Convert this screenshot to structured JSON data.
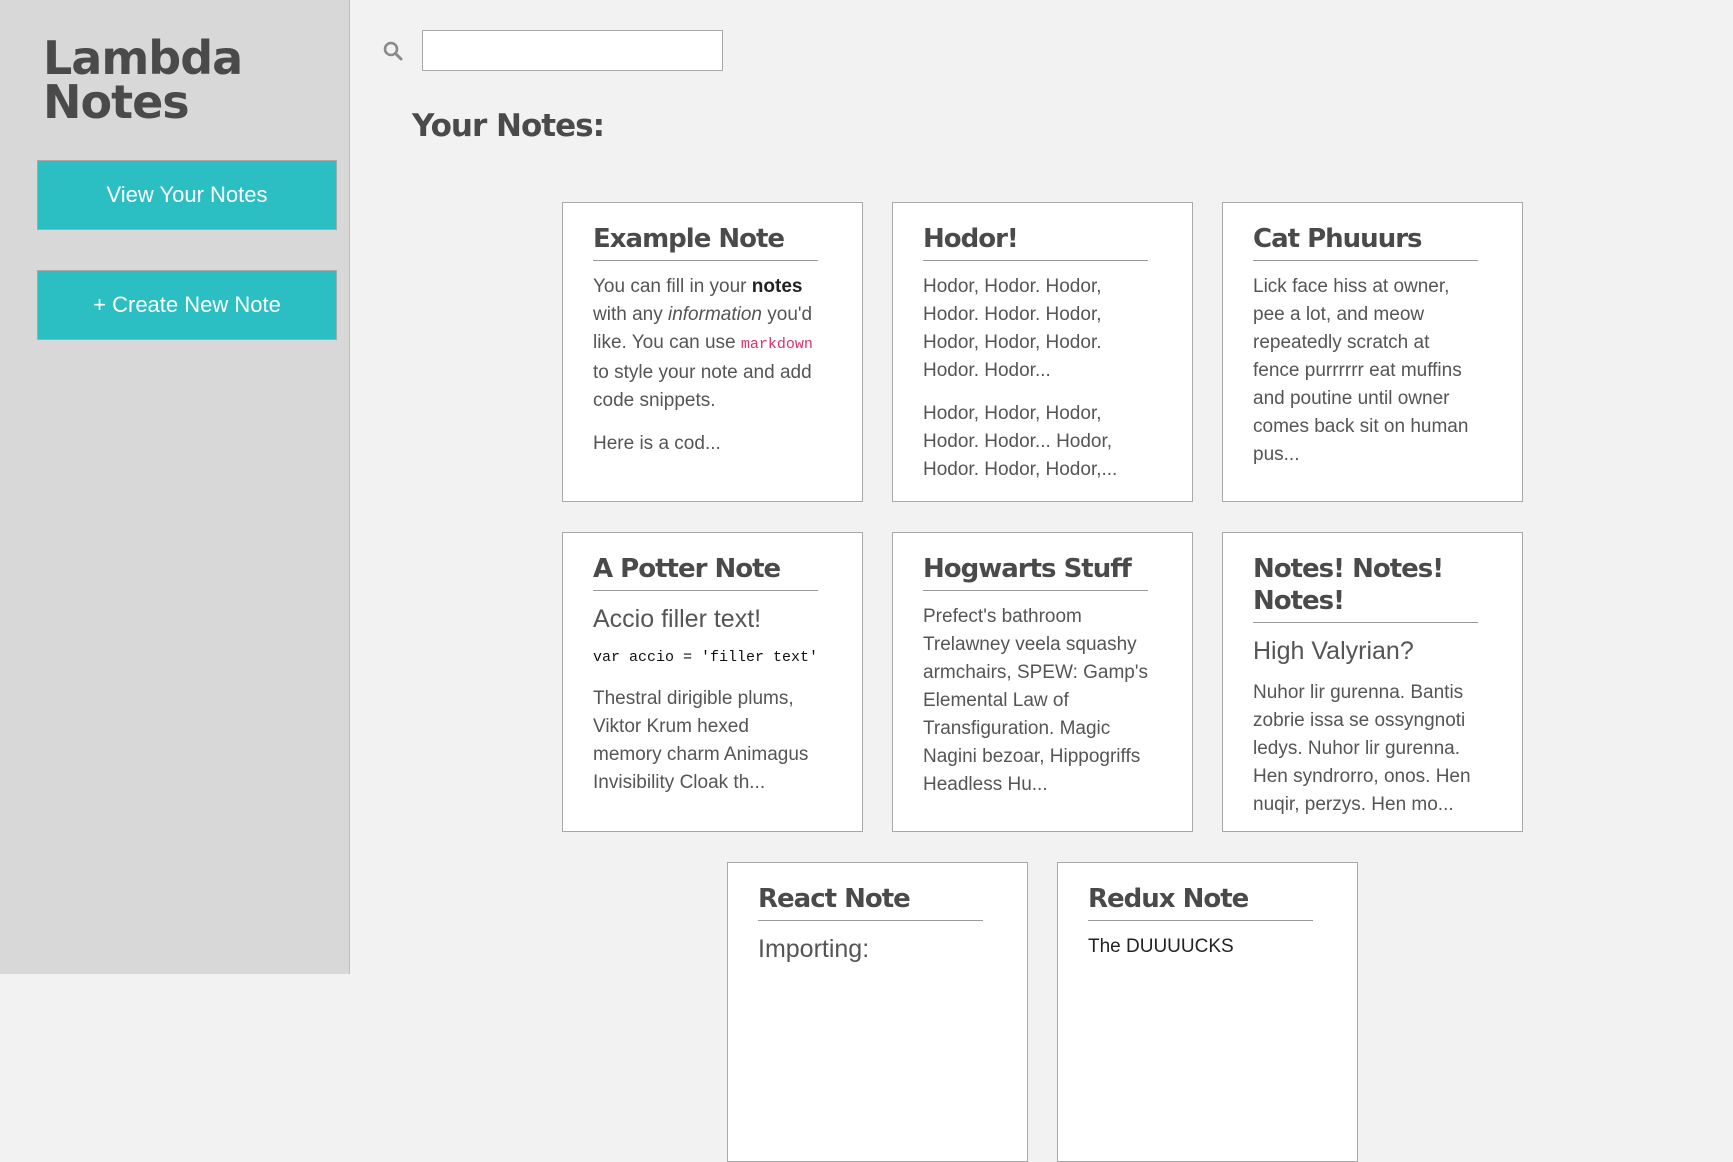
{
  "app": {
    "title_line1": "Lambda",
    "title_line2": "Notes"
  },
  "sidebar": {
    "view_notes_label": "View Your Notes",
    "create_note_label": "+ Create New Note"
  },
  "search": {
    "value": "",
    "placeholder": "",
    "icon": "search-icon"
  },
  "main": {
    "heading": "Your Notes:"
  },
  "colors": {
    "accent": "#2bbfc3",
    "sidebar_bg": "#d8d8d8",
    "page_bg": "#f2f2f2",
    "code_inline": "#d6336c"
  },
  "notes": [
    {
      "title": "Example Note",
      "p1_a": "You can fill in your ",
      "p1_bold": "notes",
      "p1_b": " with any ",
      "p1_italic": "information",
      "p1_c": " you'd like. You can use ",
      "p1_code": "markdown",
      "p1_d": " to style your note and add code snippets.",
      "p2": "Here is a cod..."
    },
    {
      "title": "Hodor!",
      "p1": "Hodor, Hodor. Hodor, Hodor. Hodor. Hodor, Hodor, Hodor, Hodor. Hodor. Hodor...",
      "p2": "Hodor, Hodor, Hodor, Hodor. Hodor... Hodor, Hodor. Hodor, Hodor,..."
    },
    {
      "title": "Cat Phuuurs",
      "p1": "Lick face hiss at owner, pee a lot, and meow repeatedly scratch at fence purrrrrr eat muffins and poutine until owner comes back sit on human pus..."
    },
    {
      "title": "A Potter Note",
      "heading": "Accio filler text!",
      "code": "var accio = 'filler text'",
      "p1": "Thestral dirigible plums, Viktor Krum hexed memory charm Animagus Invisibility Cloak th..."
    },
    {
      "title": "Hogwarts Stuff",
      "p1": "Prefect's bathroom Trelawney veela squashy armchairs, SPEW: Gamp's Elemental Law of Transfiguration. Magic Nagini bezoar, Hippogriffs Headless Hu..."
    },
    {
      "title": "Notes! Notes! Notes!",
      "heading": "High Valyrian?",
      "p1": "Nuhor lir gurenna. Bantis zobrie issa se ossyngnoti ledys. Nuhor lir gurenna. Hen syndrorro, onos. Hen nuqir, perzys. Hen mo..."
    },
    {
      "title": "React Note",
      "heading": "Importing:"
    },
    {
      "title": "Redux Note",
      "p1": "The DUUUUCKS"
    }
  ]
}
